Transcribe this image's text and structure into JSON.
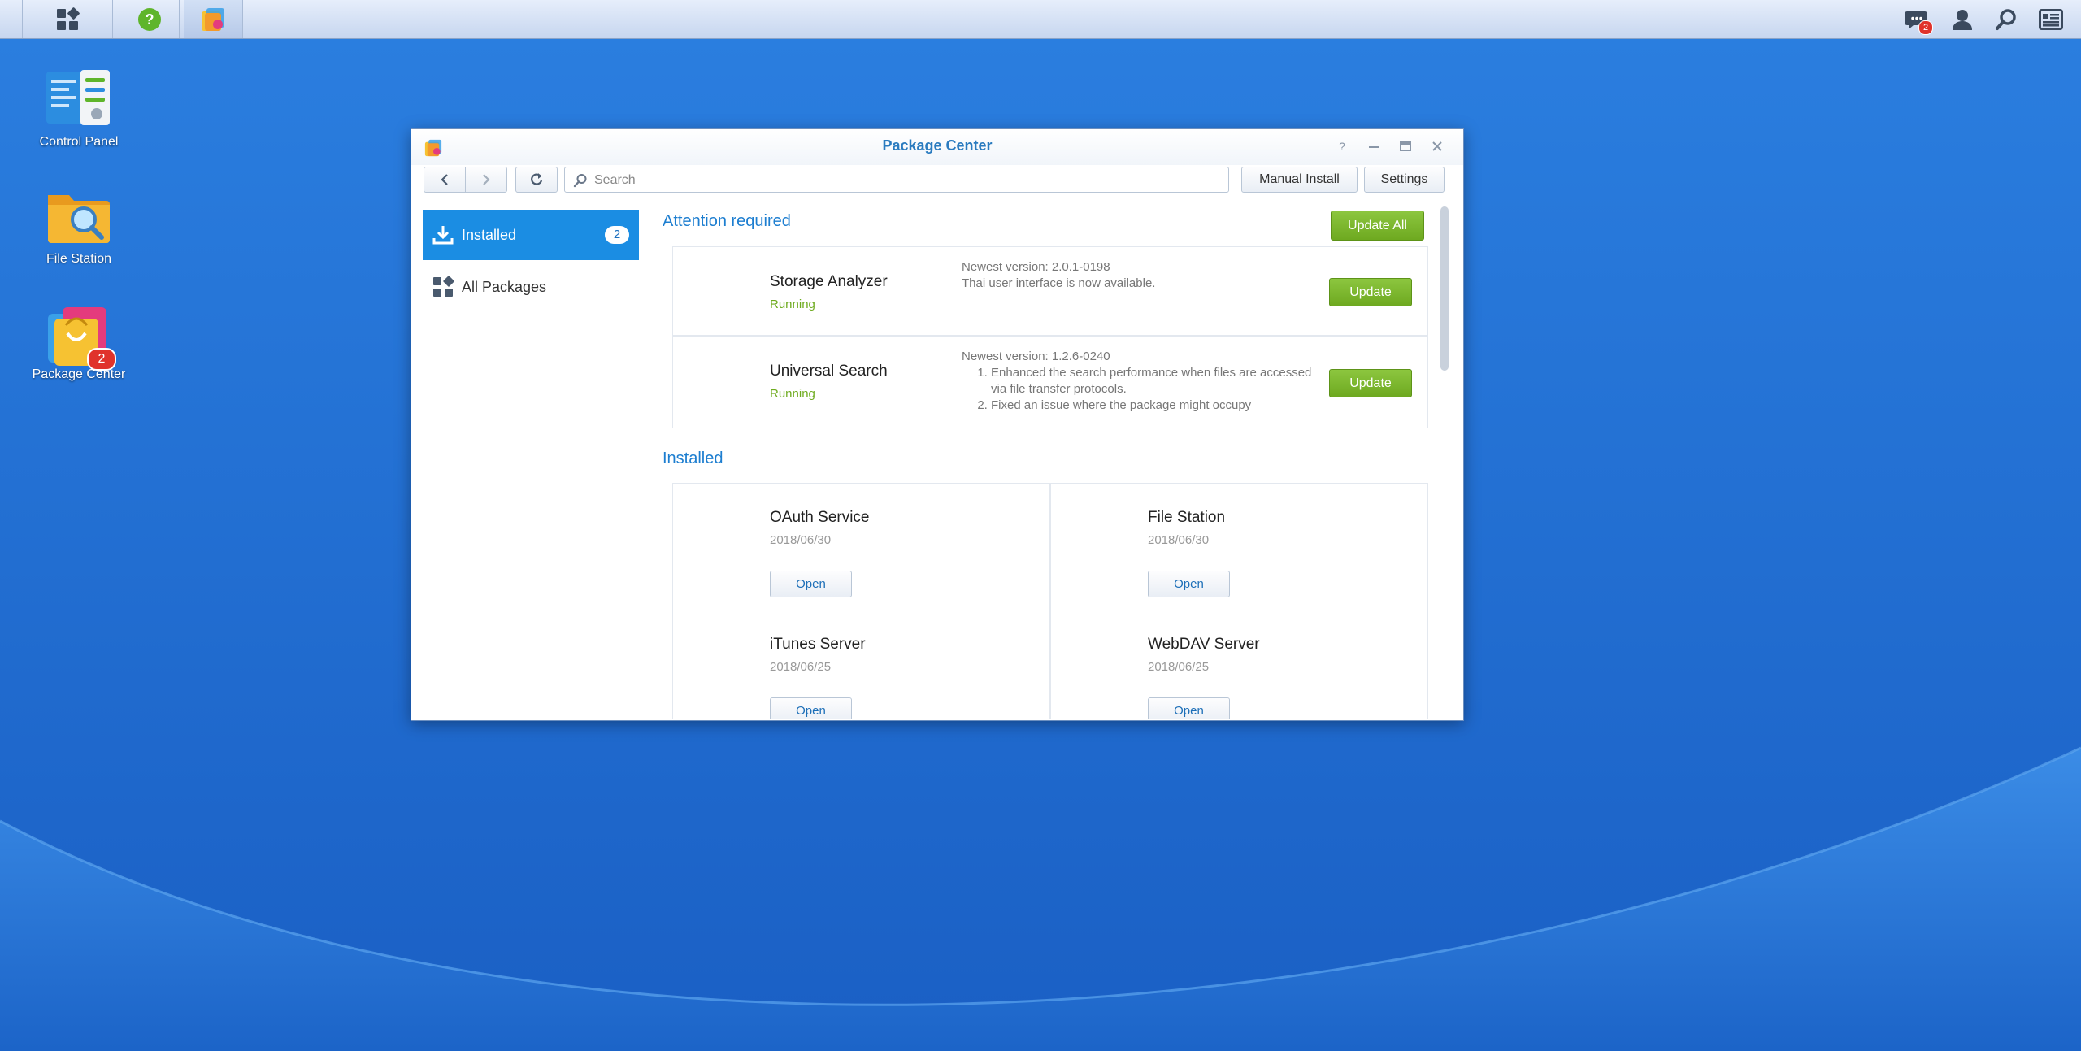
{
  "desktop": {
    "icons": [
      {
        "label": "Control Panel",
        "icon": "control-panel-icon"
      },
      {
        "label": "File Station",
        "icon": "file-station-icon"
      },
      {
        "label": "Package Center",
        "icon": "package-center-icon",
        "badge": "2"
      }
    ]
  },
  "taskbar": {
    "apps": [
      "main-menu-icon",
      "help-icon",
      "package-center-icon"
    ],
    "notifications_badge": "2",
    "right_icons": [
      "notifications-icon",
      "user-icon",
      "search-icon",
      "widgets-icon"
    ]
  },
  "window": {
    "title": "Package Center",
    "controls": [
      "help-icon",
      "minimize-icon",
      "maximize-icon",
      "close-icon"
    ],
    "toolbar": {
      "search_placeholder": "Search",
      "manual_install_label": "Manual Install",
      "settings_label": "Settings"
    },
    "sidebar": {
      "items": [
        {
          "label": "Installed",
          "count": "2",
          "icon": "download-icon",
          "active": true
        },
        {
          "label": "All Packages",
          "icon": "grid-icon",
          "active": false
        }
      ]
    },
    "main": {
      "attention_title": "Attention required",
      "update_all_label": "Update All",
      "updates": [
        {
          "name": "Storage Analyzer",
          "status": "Running",
          "newest_version": "Newest version: 2.0.1-0198",
          "notes_text": "Thai user interface is now available.",
          "button": "Update"
        },
        {
          "name": "Universal Search",
          "status": "Running",
          "newest_version": "Newest version: 1.2.6-0240",
          "notes": [
            "Enhanced the search performance when files are accessed via file transfer protocols.",
            "Fixed an issue where the package might occupy"
          ],
          "button": "Update"
        }
      ],
      "installed_title": "Installed",
      "installed": [
        {
          "name": "OAuth Service",
          "date": "2018/06/30",
          "button": "Open"
        },
        {
          "name": "File Station",
          "date": "2018/06/30",
          "button": "Open"
        },
        {
          "name": "iTunes Server",
          "date": "2018/06/25",
          "button": "Open"
        },
        {
          "name": "WebDAV Server",
          "date": "2018/06/25",
          "button": "Open"
        }
      ]
    }
  },
  "colors": {
    "accent_blue": "#1b8de3",
    "title_blue": "#2a7bbf",
    "update_green": "#7ab52d",
    "running_green": "#6eab1f",
    "desktop_blue": "#1f6fd0"
  }
}
